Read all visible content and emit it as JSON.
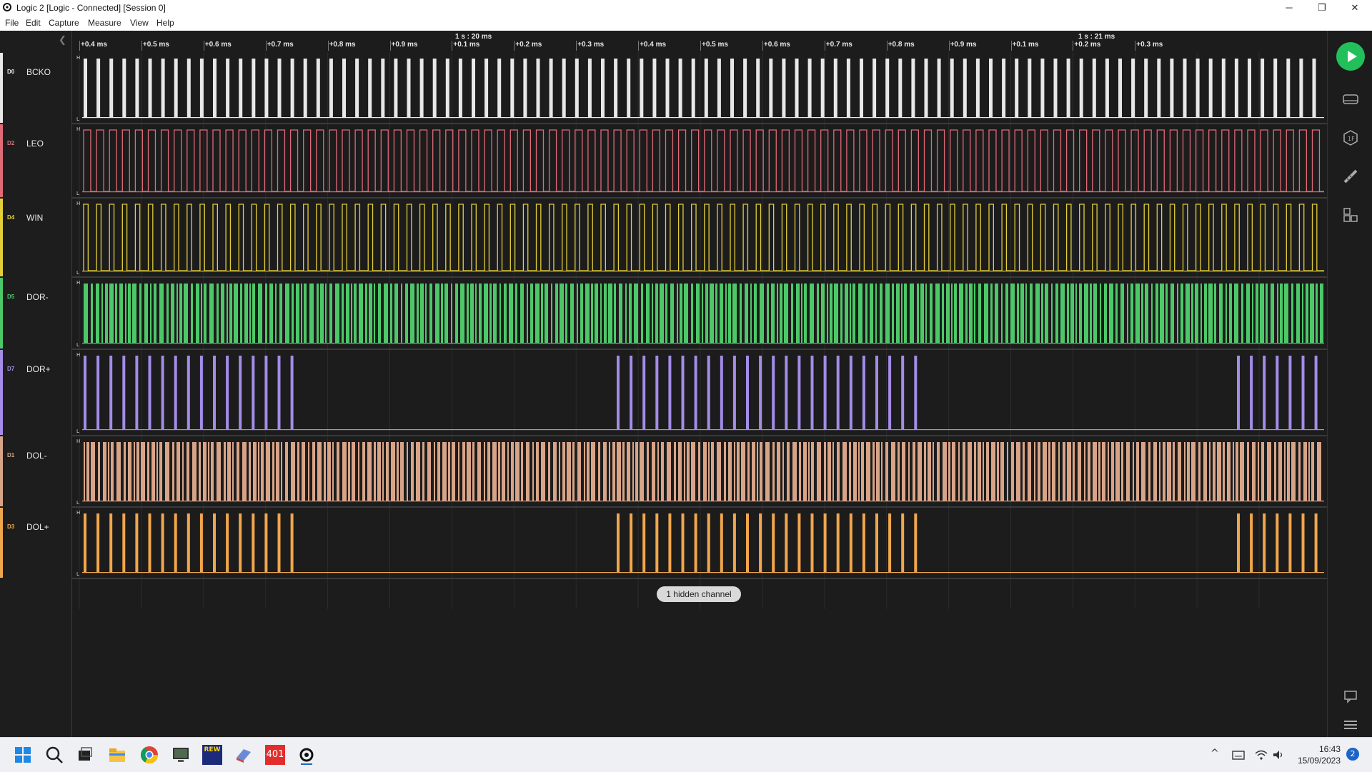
{
  "window": {
    "title": "Logic 2 [Logic - Connected] [Session 0]",
    "minimize_glyph": "─",
    "restore_glyph": "❐",
    "close_glyph": "✕"
  },
  "menu": [
    "File",
    "Edit",
    "Capture",
    "Measure",
    "View",
    "Help"
  ],
  "timeline": {
    "major_labels": [
      "1 s : 20 ms",
      "1 s : 21 ms"
    ],
    "ticks": [
      "+0.4 ms",
      "+0.5 ms",
      "+0.6 ms",
      "+0.7 ms",
      "+0.8 ms",
      "+0.9 ms",
      "+0.1 ms",
      "+0.2 ms",
      "+0.3 ms",
      "+0.4 ms",
      "+0.5 ms",
      "+0.6 ms",
      "+0.7 ms",
      "+0.8 ms",
      "+0.9 ms",
      "+0.1 ms",
      "+0.2 ms",
      "+0.3 ms"
    ]
  },
  "level_labels": {
    "high": "H",
    "low": "L"
  },
  "channels": [
    {
      "id": "D0",
      "name": "BCKO",
      "color": "#e8e8e8"
    },
    {
      "id": "D2",
      "name": "LEO",
      "color": "#e06a78"
    },
    {
      "id": "D4",
      "name": "WIN",
      "color": "#e3cf3a"
    },
    {
      "id": "D5",
      "name": "DOR-",
      "color": "#4dc868"
    },
    {
      "id": "D7",
      "name": "DOR+",
      "color": "#a48ce8"
    },
    {
      "id": "D1",
      "name": "DOL-",
      "color": "#d8a488"
    },
    {
      "id": "D3",
      "name": "DOL+",
      "color": "#f2a64c"
    }
  ],
  "hidden_channels_label": "1 hidden channel",
  "colors": {
    "play": "#22c05a",
    "background": "#1b1b1b"
  },
  "right_toolbar_icons": [
    "play-icon",
    "analyzers-icon",
    "extensions-icon",
    "measure-icon",
    "layout-icon",
    "feedback-icon",
    "menu-icon"
  ],
  "taskbar": {
    "icons": [
      "windows-start-icon",
      "search-icon",
      "task-view-icon",
      "file-explorer-icon",
      "chrome-icon",
      "monitor-app-icon",
      "rew-icon",
      "app-icon",
      "app-401-icon",
      "logic-icon"
    ],
    "rew_label": "REW",
    "app_401_label": "401",
    "time": "16:43",
    "date": "15/09/2023",
    "notification_count": "2",
    "tray_chevron_glyph": "^"
  }
}
